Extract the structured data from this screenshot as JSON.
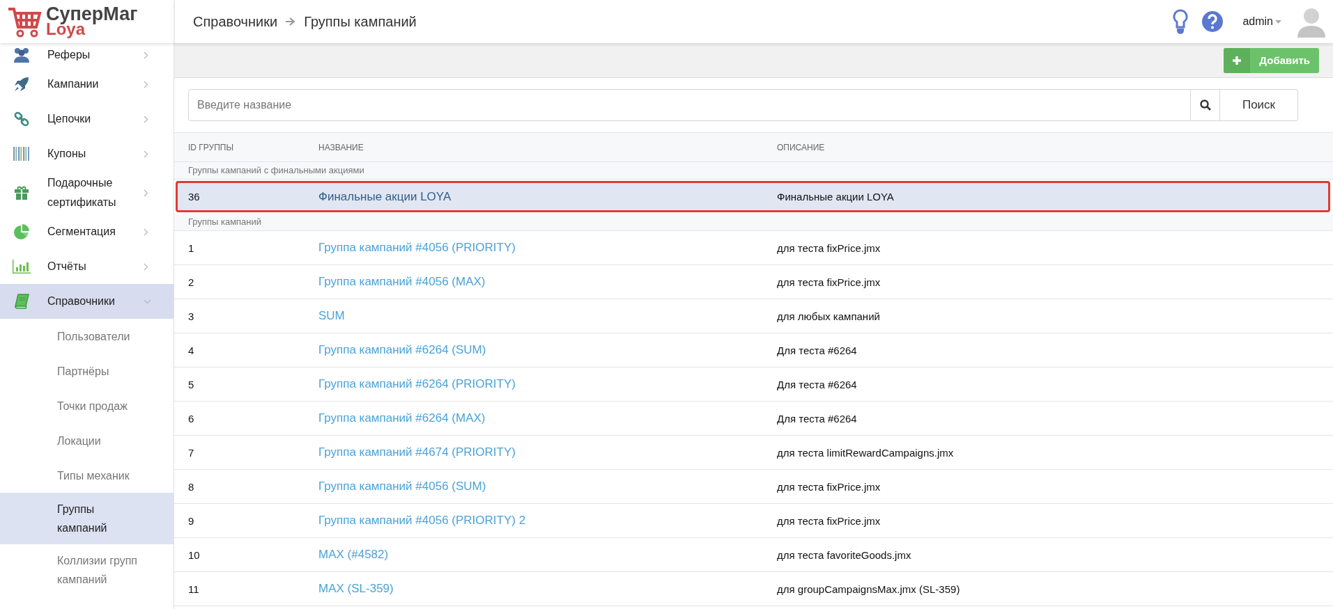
{
  "logo": {
    "title": "СуперМаг",
    "subtitle": "Loya"
  },
  "header": {
    "breadcrumbs": [
      "Справочники",
      "Группы кампаний"
    ],
    "user": "admin"
  },
  "sidebar": {
    "items": [
      {
        "label": "Реферы",
        "expanded": false,
        "selected": false
      },
      {
        "label": "Кампании",
        "expanded": false,
        "selected": false
      },
      {
        "label": "Цепочки",
        "expanded": false,
        "selected": false
      },
      {
        "label": "Купоны",
        "expanded": false,
        "selected": false
      },
      {
        "label": "Подарочные сертификаты",
        "expanded": false,
        "selected": false
      },
      {
        "label": "Сегментация",
        "expanded": false,
        "selected": false
      },
      {
        "label": "Отчёты",
        "expanded": false,
        "selected": false
      },
      {
        "label": "Справочники",
        "expanded": true,
        "selected": true,
        "children": [
          {
            "label": "Пользователи",
            "selected": false
          },
          {
            "label": "Партнёры",
            "selected": false
          },
          {
            "label": "Точки продаж",
            "selected": false
          },
          {
            "label": "Локации",
            "selected": false
          },
          {
            "label": "Типы механик",
            "selected": false
          },
          {
            "label": "Группы кампаний",
            "selected": true
          },
          {
            "label": "Коллизии групп кампаний",
            "selected": false
          }
        ]
      }
    ]
  },
  "toolbar": {
    "add_button": "Добавить"
  },
  "search": {
    "placeholder": "Введите название",
    "button": "Поиск"
  },
  "table": {
    "columns": [
      "ID ГРУППЫ",
      "НАЗВАНИЕ",
      "ОПИСАНИЕ"
    ],
    "sections": [
      {
        "label": "Группы кампаний с финальными акциями",
        "rows": [
          {
            "id": "36",
            "name": "Финальные акции LOYA",
            "description": "Финальные акции LOYA",
            "highlighted": true
          }
        ]
      },
      {
        "label": "Группы кампаний",
        "rows": [
          {
            "id": "1",
            "name": "Группа кампаний #4056 (PRIORITY)",
            "description": "для теста fixPrice.jmx",
            "highlighted": false
          },
          {
            "id": "2",
            "name": "Группа кампаний #4056 (MAX)",
            "description": "для теста fixPrice.jmx",
            "highlighted": false
          },
          {
            "id": "3",
            "name": "SUM",
            "description": "для любых кампаний",
            "highlighted": false
          },
          {
            "id": "4",
            "name": "Группа кампаний #6264 (SUM)",
            "description": "Для теста #6264",
            "highlighted": false
          },
          {
            "id": "5",
            "name": "Группа кампаний #6264 (PRIORITY)",
            "description": "Для теста #6264",
            "highlighted": false
          },
          {
            "id": "6",
            "name": "Группа кампаний #6264 (MAX)",
            "description": "Для теста #6264",
            "highlighted": false
          },
          {
            "id": "7",
            "name": "Группа кампаний #4674 (PRIORITY)",
            "description": "для теста limitRewardCampaigns.jmx",
            "highlighted": false
          },
          {
            "id": "8",
            "name": "Группа кампаний #4056 (SUM)",
            "description": "для теста fixPrice.jmx",
            "highlighted": false
          },
          {
            "id": "9",
            "name": "Группа кампаний #4056 (PRIORITY) 2",
            "description": "для теста fixPrice.jmx",
            "highlighted": false
          },
          {
            "id": "10",
            "name": "MAX (#4582)",
            "description": "для теста favoriteGoods.jmx",
            "highlighted": false
          },
          {
            "id": "11",
            "name": "MAX (SL-359)",
            "description": "для groupCampaignsMax.jmx (SL-359)",
            "highlighted": false
          }
        ]
      }
    ]
  }
}
